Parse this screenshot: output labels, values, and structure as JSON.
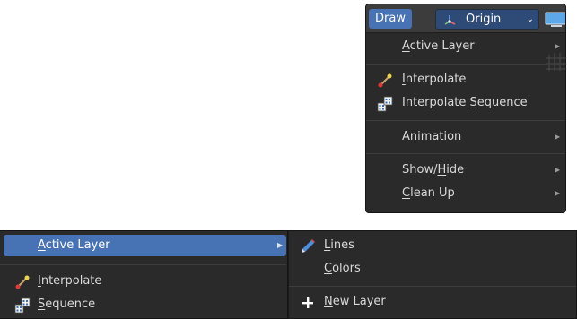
{
  "header": {
    "draw_tab": "Draw",
    "origin_dropdown": "Origin",
    "icons": [
      "origin-axes-icon",
      "chevron-down-icon",
      "display-icon"
    ]
  },
  "draw_menu": {
    "items": [
      {
        "label": "Active Layer",
        "underline": "A",
        "submenu": true
      },
      {
        "label": "Interpolate",
        "underline": "I",
        "icon": "interpolate-icon"
      },
      {
        "label": "Interpolate Sequence",
        "underline": "S",
        "icon": "interpolate-sequence-icon"
      },
      {
        "label": "Animation",
        "underline": "n",
        "submenu": true
      },
      {
        "label": "Show/Hide",
        "underline": "H",
        "submenu": true
      },
      {
        "label": "Clean Up",
        "underline": "C",
        "submenu": true
      }
    ]
  },
  "interpolate_submenu": {
    "items": [
      {
        "label": "Active Layer",
        "underline": "A",
        "submenu": true,
        "highlighted": true
      },
      {
        "label": "Interpolate",
        "underline": "I",
        "icon": "interpolate-icon"
      },
      {
        "label": "Sequence",
        "underline": "S",
        "icon": "interpolate-sequence-icon"
      }
    ]
  },
  "active_layer_submenu": {
    "items": [
      {
        "label": "Lines",
        "underline": "L",
        "icon": "pencil-icon"
      },
      {
        "label": "Colors",
        "underline": "C"
      },
      {
        "label": "New Layer",
        "underline": "N",
        "icon": "plus-icon"
      }
    ]
  },
  "colors": {
    "menu_bg": "#2a2a2a",
    "header_bg": "#3c3c3c",
    "highlight": "#4772b3",
    "dropdown_bg": "#2e4a77",
    "text": "#d9d9d9"
  }
}
